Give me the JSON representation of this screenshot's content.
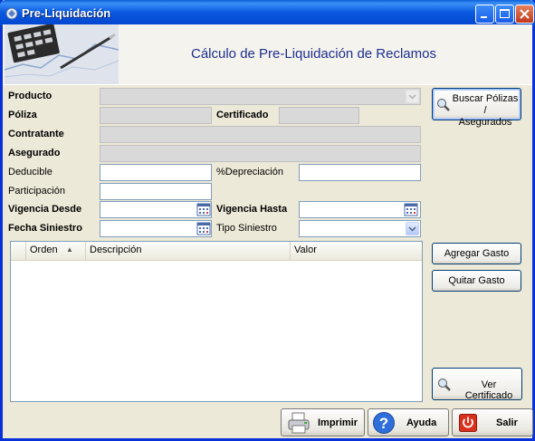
{
  "window": {
    "title": "Pre-Liquidación"
  },
  "header": {
    "title": "Cálculo de Pre-Liquidación de Reclamos"
  },
  "form": {
    "producto": "Producto",
    "poliza": "Póliza",
    "certificado": "Certificado",
    "contratante": "Contratante",
    "asegurado": "Asegurado",
    "deducible": "Deducible",
    "depreciacion": "%Depreciación",
    "participacion": "Participación",
    "vigencia_desde": "Vigencia Desde",
    "vigencia_hasta": "Vigencia Hasta",
    "fecha_siniestro": "Fecha Siniestro",
    "tipo_siniestro": "Tipo Siniestro"
  },
  "buttons": {
    "buscar_line1": "Buscar Pólizas /",
    "buscar_line2": "Asegurados",
    "agregar_gasto": "Agregar Gasto",
    "quitar_gasto": "Quitar Gasto",
    "ver_certificado": "Ver Certificado",
    "imprimir": "Imprimir",
    "ayuda": "Ayuda",
    "salir": "Salir"
  },
  "grid": {
    "columns": [
      "Orden",
      "Descripción",
      "Valor"
    ],
    "sort_indicator": "▲"
  },
  "colors": {
    "title_blue": "#1c2f8f",
    "titlebar": "#0a5ae0"
  }
}
